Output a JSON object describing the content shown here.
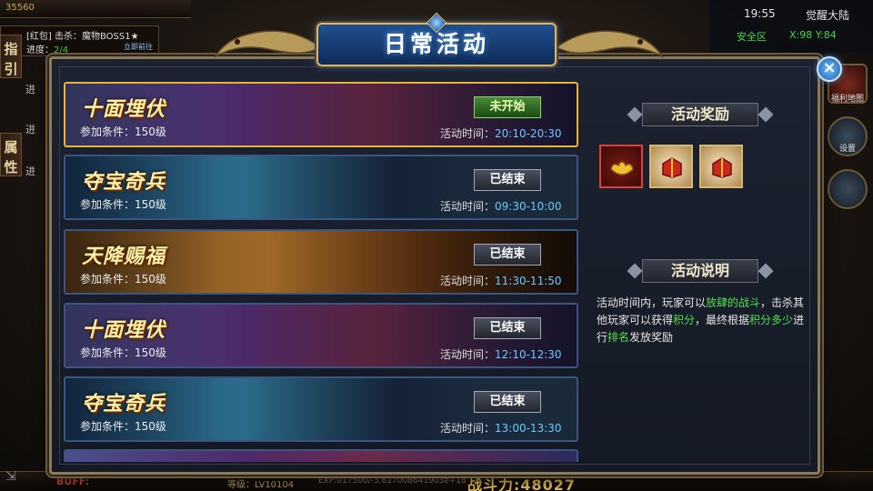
{
  "hud": {
    "coin": "35560",
    "quest_line1": "[红包] 击杀：魔物BOSS1★",
    "quest_line2_label": "进度：",
    "quest_progress": "2/4",
    "quest_goto": "立即前往",
    "tab_guide": "指引",
    "tab_attr": "属性",
    "side_ghost_1": "进",
    "side_ghost_2": "进",
    "side_ghost_3": "进",
    "time": "19:55",
    "zone": "觉醒大陆",
    "safe_zone": "安全区",
    "coords": "X:98 Y:84",
    "welfare_map": "福利地图",
    "settings": "设置",
    "buff": "BUFF:",
    "level": "等级：LV10104",
    "exp": "EXP:017500/-3.617008641903e+18",
    "power": "战斗力:48027"
  },
  "dialog": {
    "title": "日常活动",
    "close": "×"
  },
  "activities": [
    {
      "name": "十面埋伏",
      "condition": "参加条件：150级",
      "status": "未开始",
      "time_label": "活动时间：",
      "time_value": "20:10-20:30"
    },
    {
      "name": "夺宝奇兵",
      "condition": "参加条件：150级",
      "status": "已结束",
      "time_label": "活动时间：",
      "time_value": "09:30-10:00"
    },
    {
      "name": "天降赐福",
      "condition": "参加条件：150级",
      "status": "已结束",
      "time_label": "活动时间：",
      "time_value": "11:30-11:50"
    },
    {
      "name": "十面埋伏",
      "condition": "参加条件：150级",
      "status": "已结束",
      "time_label": "活动时间：",
      "time_value": "12:10-12:30"
    },
    {
      "name": "夺宝奇兵",
      "condition": "参加条件：150级",
      "status": "已结束",
      "time_label": "活动时间：",
      "time_value": "13:00-13:30"
    }
  ],
  "right_panel": {
    "reward_title": "活动奖励",
    "rewards": [
      {
        "icon": "gold-ingot-icon"
      },
      {
        "icon": "red-gift-box-icon"
      },
      {
        "icon": "red-gift-box-icon"
      }
    ],
    "desc_title": "活动说明",
    "desc": {
      "t1": "活动时间内，玩家可以",
      "h1": "放肆的战斗",
      "t2": "，击杀其他玩家可以获得",
      "h2": "积分",
      "t3": "，最终根据",
      "h3": "积分多少",
      "t4": "进行",
      "h4": "排名",
      "t5": "发放奖励"
    }
  },
  "colors": {
    "accent_gold": "#d8b870",
    "time_value": "#6ac8ff",
    "highlight_green": "#4fe04f",
    "selected_border": "#e8b33a"
  }
}
